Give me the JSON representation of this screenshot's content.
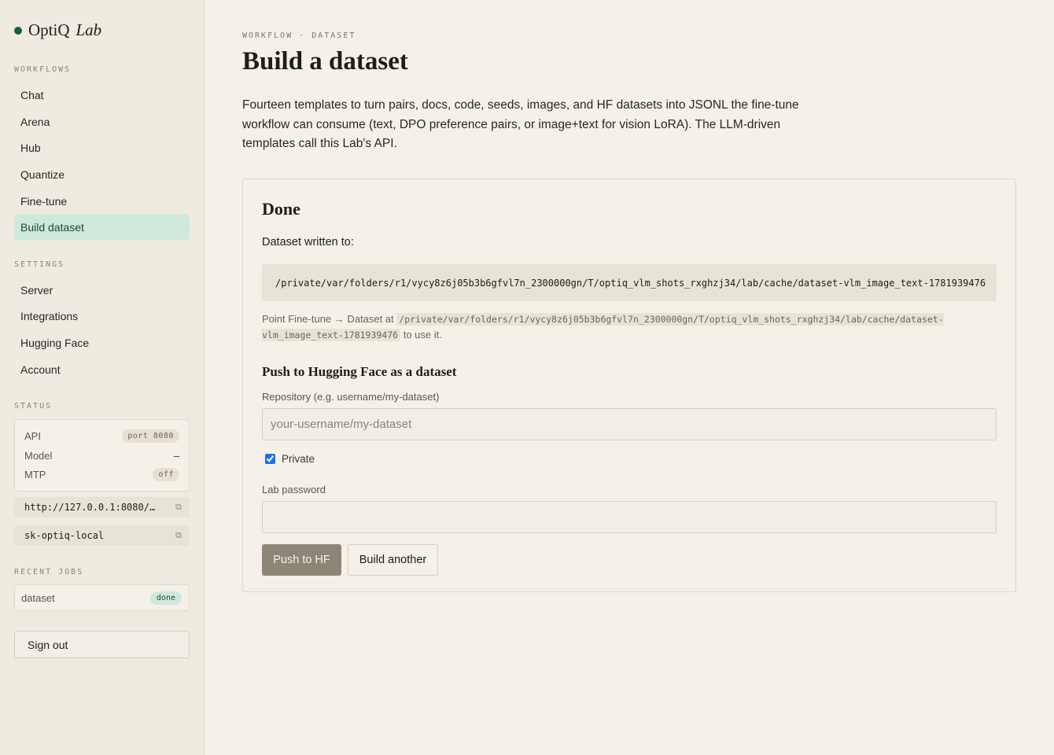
{
  "brand": {
    "name": "OptiQ",
    "suffix": "Lab"
  },
  "sidebar": {
    "workflows_label": "WORKFLOWS",
    "workflows": [
      {
        "label": "Chat"
      },
      {
        "label": "Arena"
      },
      {
        "label": "Hub"
      },
      {
        "label": "Quantize"
      },
      {
        "label": "Fine-tune"
      },
      {
        "label": "Build dataset",
        "active": true
      }
    ],
    "settings_label": "SETTINGS",
    "settings": [
      {
        "label": "Server"
      },
      {
        "label": "Integrations"
      },
      {
        "label": "Hugging Face"
      },
      {
        "label": "Account"
      }
    ],
    "status_label": "STATUS",
    "status": {
      "api_label": "API",
      "api_value": "port 8080",
      "model_label": "Model",
      "model_value": "–",
      "mtp_label": "MTP",
      "mtp_value": "off"
    },
    "endpoint": "http://127.0.0.1:8080/…",
    "api_key": "sk-optiq-local",
    "recent_jobs_label": "RECENT JOBS",
    "recent_jobs": [
      {
        "name": "dataset",
        "status": "done"
      }
    ],
    "sign_out": "Sign out"
  },
  "main": {
    "breadcrumb": "WORKFLOW · DATASET",
    "title": "Build a dataset",
    "description": "Fourteen templates to turn pairs, docs, code, seeds, images, and HF datasets into JSONL the fine-tune workflow can consume (text, DPO preference pairs, or image+text for vision LoRA). The LLM-driven templates call this Lab's API.",
    "result": {
      "title": "Done",
      "written_label": "Dataset written to:",
      "path": "/private/var/folders/r1/vycy8z6j05b3b6gfvl7n_2300000gn/T/optiq_vlm_shots_rxghzj34/lab/cache/dataset-vlm_image_text-1781939476",
      "hint_prefix": "Point Fine-tune → Dataset at",
      "hint_path": "/private/var/folders/r1/vycy8z6j05b3b6gfvl7n_2300000gn/T/optiq_vlm_shots_rxghzj34/lab/cache/dataset-vlm_image_text-1781939476",
      "hint_suffix": "to use it."
    },
    "push": {
      "title": "Push to Hugging Face as a dataset",
      "repo_label": "Repository (e.g. username/my-dataset)",
      "repo_placeholder": "your-username/my-dataset",
      "repo_value": "",
      "private_label": "Private",
      "private_checked": true,
      "password_label": "Lab password",
      "password_value": "",
      "push_button": "Push to HF",
      "another_button": "Build another"
    }
  },
  "colors": {
    "accent": "#1e5b40",
    "active_nav_bg": "#cfe8dc",
    "background": "#f5f1e8",
    "sidebar_bg": "#efebe1",
    "primary_button": "#8d8678"
  }
}
